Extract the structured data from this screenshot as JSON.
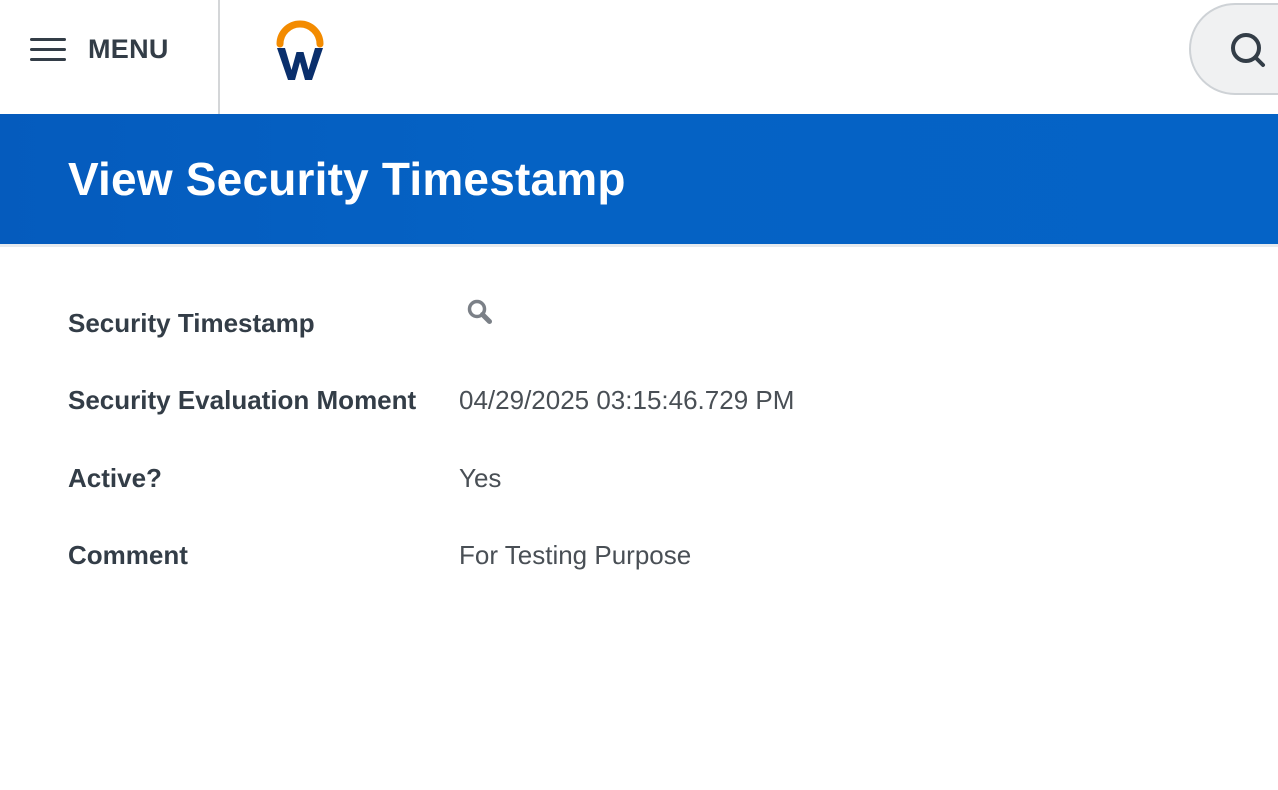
{
  "header": {
    "menu_label": "MENU",
    "logo_icon": "workday-logo",
    "search_icon": "search-icon",
    "accent_colors": {
      "logo_arc": "#f38b00",
      "logo_w": "#0a2f6c",
      "banner": "#0562c4"
    }
  },
  "page": {
    "title": "View Security Timestamp"
  },
  "fields": [
    {
      "label": "Security Timestamp",
      "value": "",
      "icon": "magnifier-prompt-icon"
    },
    {
      "label": "Security Evaluation Moment",
      "value": "04/29/2025 03:15:46.729 PM"
    },
    {
      "label": "Active?",
      "value": "Yes"
    },
    {
      "label": "Comment",
      "value": "For Testing Purpose"
    }
  ]
}
